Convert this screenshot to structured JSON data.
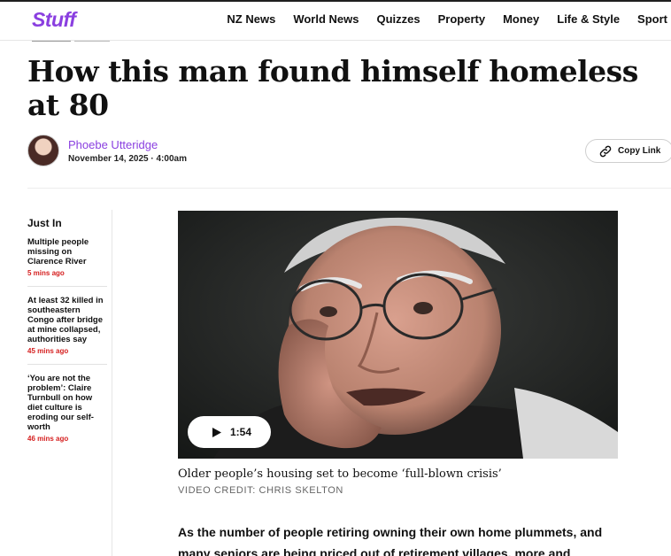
{
  "header": {
    "logo": "Stuff",
    "nav": [
      "NZ News",
      "World News",
      "Quizzes",
      "Property",
      "Money",
      "Life & Style",
      "Sport"
    ]
  },
  "article": {
    "headline": "How this man found himself homeless at 80",
    "author": "Phoebe Utteridge",
    "date": "November 14, 2025 · 4:00am",
    "copy_link_label": "Copy Link",
    "video": {
      "duration": "1:54",
      "caption": "Older people’s housing set to become ‘full-blown crisis’",
      "credit": "VIDEO CREDIT: CHRIS SKELTON"
    },
    "body": "As the number of people retiring owning their own home plummets, and many seniors are being priced out of retirement villages, more and"
  },
  "sidebar": {
    "heading": "Just In",
    "items": [
      {
        "title": "Multiple people missing on Clarence River",
        "time": "5 mins ago"
      },
      {
        "title": "At least 32 killed in southeastern Congo after bridge at mine collapsed, authorities say",
        "time": "45 mins ago"
      },
      {
        "title": "‘You are not the problem’: Claire Turnbull on how diet culture is eroding our self-worth",
        "time": "46 mins ago"
      }
    ]
  },
  "colors": {
    "brand": "#8a3fe0",
    "time_red": "#d51f1f"
  }
}
